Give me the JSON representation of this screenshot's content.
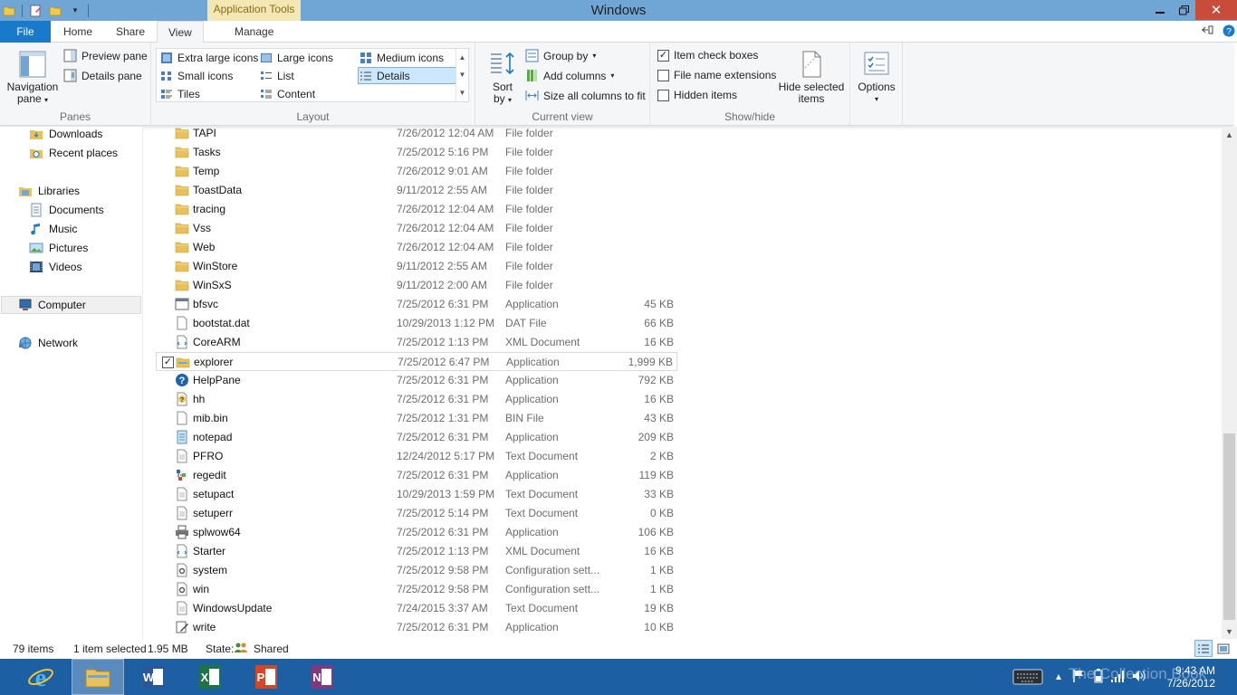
{
  "window": {
    "title": "Windows",
    "contextual_tab_group": "Application Tools"
  },
  "tabs": {
    "file": "File",
    "home": "Home",
    "share": "Share",
    "view": "View",
    "manage": "Manage"
  },
  "ribbon": {
    "panes": {
      "label": "Panes",
      "navigation_pane": "Navigation",
      "navigation_pane_2": "pane",
      "preview_pane": "Preview pane",
      "details_pane": "Details pane"
    },
    "layout": {
      "label": "Layout",
      "extra_large_icons": "Extra large icons",
      "large_icons": "Large icons",
      "medium_icons": "Medium icons",
      "small_icons": "Small icons",
      "list": "List",
      "details": "Details",
      "tiles": "Tiles",
      "content": "Content",
      "selected": "Details"
    },
    "current_view": {
      "label": "Current view",
      "sort_by": "Sort",
      "sort_by_2": "by",
      "group_by": "Group by",
      "add_columns": "Add columns",
      "size_all_columns": "Size all columns to fit"
    },
    "show_hide": {
      "label": "Show/hide",
      "item_check_boxes": "Item check boxes",
      "item_check_boxes_checked": true,
      "file_name_extensions": "File name extensions",
      "file_name_extensions_checked": false,
      "hidden_items": "Hidden items",
      "hidden_items_checked": false,
      "hide_selected_items": "Hide selected",
      "hide_selected_items_2": "items"
    },
    "options": {
      "label": "Options"
    }
  },
  "navigation": {
    "items": [
      {
        "label": "Downloads",
        "icon": "downloads-folder-icon"
      },
      {
        "label": "Recent places",
        "icon": "recent-places-icon"
      },
      {
        "label": "Libraries",
        "icon": "libraries-icon"
      },
      {
        "label": "Documents",
        "icon": "documents-library-icon"
      },
      {
        "label": "Music",
        "icon": "music-library-icon"
      },
      {
        "label": "Pictures",
        "icon": "pictures-library-icon"
      },
      {
        "label": "Videos",
        "icon": "videos-library-icon"
      },
      {
        "label": "Computer",
        "icon": "computer-icon"
      },
      {
        "label": "Network",
        "icon": "network-icon"
      }
    ]
  },
  "files": [
    {
      "name": "TAPI",
      "date": "7/26/2012 12:04 AM",
      "type": "File folder",
      "size": "",
      "icon": "folder-icon"
    },
    {
      "name": "Tasks",
      "date": "7/25/2012 5:16 PM",
      "type": "File folder",
      "size": "",
      "icon": "folder-icon"
    },
    {
      "name": "Temp",
      "date": "7/26/2012 9:01 AM",
      "type": "File folder",
      "size": "",
      "icon": "folder-icon"
    },
    {
      "name": "ToastData",
      "date": "9/11/2012 2:55 AM",
      "type": "File folder",
      "size": "",
      "icon": "folder-icon"
    },
    {
      "name": "tracing",
      "date": "7/26/2012 12:04 AM",
      "type": "File folder",
      "size": "",
      "icon": "folder-icon"
    },
    {
      "name": "Vss",
      "date": "7/26/2012 12:04 AM",
      "type": "File folder",
      "size": "",
      "icon": "folder-icon"
    },
    {
      "name": "Web",
      "date": "7/26/2012 12:04 AM",
      "type": "File folder",
      "size": "",
      "icon": "folder-icon"
    },
    {
      "name": "WinStore",
      "date": "9/11/2012 2:55 AM",
      "type": "File folder",
      "size": "",
      "icon": "folder-icon"
    },
    {
      "name": "WinSxS",
      "date": "9/11/2012 2:00 AM",
      "type": "File folder",
      "size": "",
      "icon": "folder-icon"
    },
    {
      "name": "bfsvc",
      "date": "7/25/2012 6:31 PM",
      "type": "Application",
      "size": "45 KB",
      "icon": "application-icon"
    },
    {
      "name": "bootstat.dat",
      "date": "10/29/2013 1:12 PM",
      "type": "DAT File",
      "size": "66 KB",
      "icon": "file-icon"
    },
    {
      "name": "CoreARM",
      "date": "7/25/2012 1:13 PM",
      "type": "XML Document",
      "size": "16 KB",
      "icon": "xml-document-icon"
    },
    {
      "name": "explorer",
      "date": "7/25/2012 6:47 PM",
      "type": "Application",
      "size": "1,999 KB",
      "icon": "explorer-icon",
      "checked": true
    },
    {
      "name": "HelpPane",
      "date": "7/25/2012 6:31 PM",
      "type": "Application",
      "size": "792 KB",
      "icon": "help-icon"
    },
    {
      "name": "hh",
      "date": "7/25/2012 6:31 PM",
      "type": "Application",
      "size": "16 KB",
      "icon": "help-file-icon"
    },
    {
      "name": "mib.bin",
      "date": "7/25/2012 1:31 PM",
      "type": "BIN File",
      "size": "43 KB",
      "icon": "file-icon"
    },
    {
      "name": "notepad",
      "date": "7/25/2012 6:31 PM",
      "type": "Application",
      "size": "209 KB",
      "icon": "notepad-icon"
    },
    {
      "name": "PFRO",
      "date": "12/24/2012 5:17 PM",
      "type": "Text Document",
      "size": "2 KB",
      "icon": "text-document-icon"
    },
    {
      "name": "regedit",
      "date": "7/25/2012 6:31 PM",
      "type": "Application",
      "size": "119 KB",
      "icon": "regedit-icon"
    },
    {
      "name": "setupact",
      "date": "10/29/2013 1:59 PM",
      "type": "Text Document",
      "size": "33 KB",
      "icon": "text-document-icon"
    },
    {
      "name": "setuperr",
      "date": "7/25/2012 5:14 PM",
      "type": "Text Document",
      "size": "0 KB",
      "icon": "text-document-icon"
    },
    {
      "name": "splwow64",
      "date": "7/25/2012 6:31 PM",
      "type": "Application",
      "size": "106 KB",
      "icon": "printer-icon"
    },
    {
      "name": "Starter",
      "date": "7/25/2012 1:13 PM",
      "type": "XML Document",
      "size": "16 KB",
      "icon": "xml-document-icon"
    },
    {
      "name": "system",
      "date": "7/25/2012 9:58 PM",
      "type": "Configuration sett...",
      "size": "1 KB",
      "icon": "config-icon"
    },
    {
      "name": "win",
      "date": "7/25/2012 9:58 PM",
      "type": "Configuration sett...",
      "size": "1 KB",
      "icon": "config-icon"
    },
    {
      "name": "WindowsUpdate",
      "date": "7/24/2015 3:37 AM",
      "type": "Text Document",
      "size": "19 KB",
      "icon": "text-document-icon"
    },
    {
      "name": "write",
      "date": "7/25/2012 6:31 PM",
      "type": "Application",
      "size": "10 KB",
      "icon": "write-icon"
    }
  ],
  "status": {
    "items_count": "79 items",
    "selection": "1 item selected",
    "selection_size": "1.95 MB",
    "state_label": "State:",
    "state_value": "Shared"
  },
  "taskbar": {
    "apps": [
      {
        "name": "Internet Explorer",
        "icon": "internet-explorer-icon"
      },
      {
        "name": "File Explorer",
        "icon": "file-explorer-icon",
        "active": true
      },
      {
        "name": "Word",
        "icon": "word-icon"
      },
      {
        "name": "Excel",
        "icon": "excel-icon"
      },
      {
        "name": "PowerPoint",
        "icon": "powerpoint-icon"
      },
      {
        "name": "OneNote",
        "icon": "onenote-icon"
      }
    ],
    "time": "9:43 AM",
    "date": "7/26/2012",
    "watermark": "The Collection Book"
  },
  "colors": {
    "titlebar": "#6fa6d6",
    "file_tab": "#1979ca",
    "close_button": "#c94b3a",
    "contextual_tab": "#f3e8b4",
    "taskbar": "#1c5fa3",
    "selection": "#cce8ff",
    "folder": "#e8c15a"
  }
}
